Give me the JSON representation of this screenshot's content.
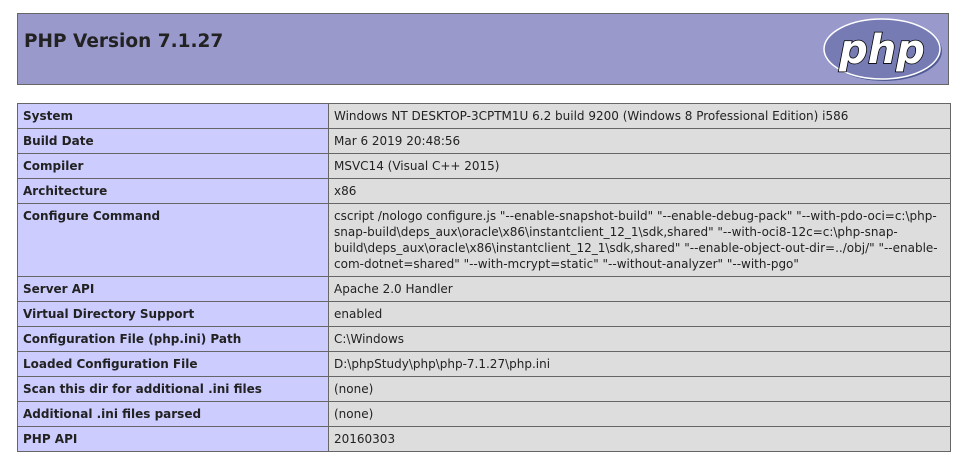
{
  "header": {
    "title": "PHP Version 7.1.27",
    "logo_text": "php"
  },
  "rows": [
    {
      "label": "System",
      "value": "Windows NT DESKTOP-3CPTM1U 6.2 build 9200 (Windows 8 Professional Edition) i586"
    },
    {
      "label": "Build Date",
      "value": "Mar 6 2019 20:48:56"
    },
    {
      "label": "Compiler",
      "value": "MSVC14 (Visual C++ 2015)"
    },
    {
      "label": "Architecture",
      "value": "x86"
    },
    {
      "label": "Configure Command",
      "value": "cscript /nologo configure.js \"--enable-snapshot-build\" \"--enable-debug-pack\" \"--with-pdo-oci=c:\\php-snap-build\\deps_aux\\oracle\\x86\\instantclient_12_1\\sdk,shared\" \"--with-oci8-12c=c:\\php-snap-build\\deps_aux\\oracle\\x86\\instantclient_12_1\\sdk,shared\" \"--enable-object-out-dir=../obj/\" \"--enable-com-dotnet=shared\" \"--with-mcrypt=static\" \"--without-analyzer\" \"--with-pgo\""
    },
    {
      "label": "Server API",
      "value": "Apache 2.0 Handler"
    },
    {
      "label": "Virtual Directory Support",
      "value": "enabled"
    },
    {
      "label": "Configuration File (php.ini) Path",
      "value": "C:\\Windows"
    },
    {
      "label": "Loaded Configuration File",
      "value": "D:\\phpStudy\\php\\php-7.1.27\\php.ini"
    },
    {
      "label": "Scan this dir for additional .ini files",
      "value": "(none)"
    },
    {
      "label": "Additional .ini files parsed",
      "value": "(none)"
    },
    {
      "label": "PHP API",
      "value": "20160303"
    }
  ],
  "colors": {
    "header_bg": "#9999cc",
    "label_bg": "#ccccff",
    "value_bg": "#dddddd",
    "logo_fill": "#777bb3"
  }
}
